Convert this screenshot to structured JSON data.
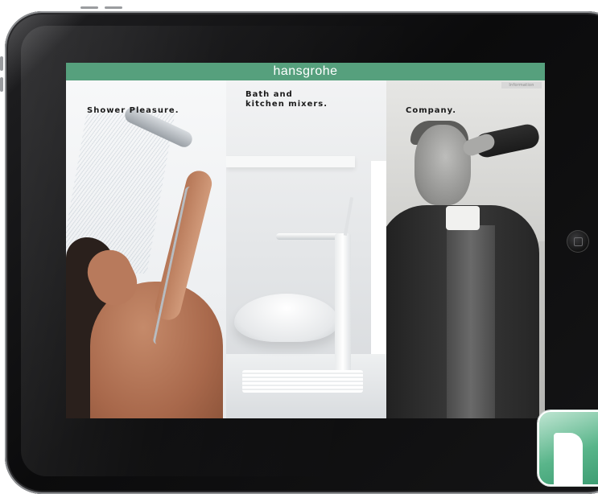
{
  "app": {
    "brand": "hansgrohe",
    "corner_label": "Information"
  },
  "panels": [
    {
      "id": "shower",
      "label_lines": [
        "Shower Pleasure."
      ]
    },
    {
      "id": "bath",
      "label_lines": [
        "Bath and",
        "kitchen mixers."
      ]
    },
    {
      "id": "company",
      "label_lines": [
        "Company."
      ]
    }
  ],
  "colors": {
    "brand_green": "#56a07d",
    "frame": "#0b0b0c",
    "label_text": "#1a1a1a"
  },
  "icons": {
    "home_button": "home-button-icon",
    "app_icon": "hansgrohe-app-icon"
  }
}
